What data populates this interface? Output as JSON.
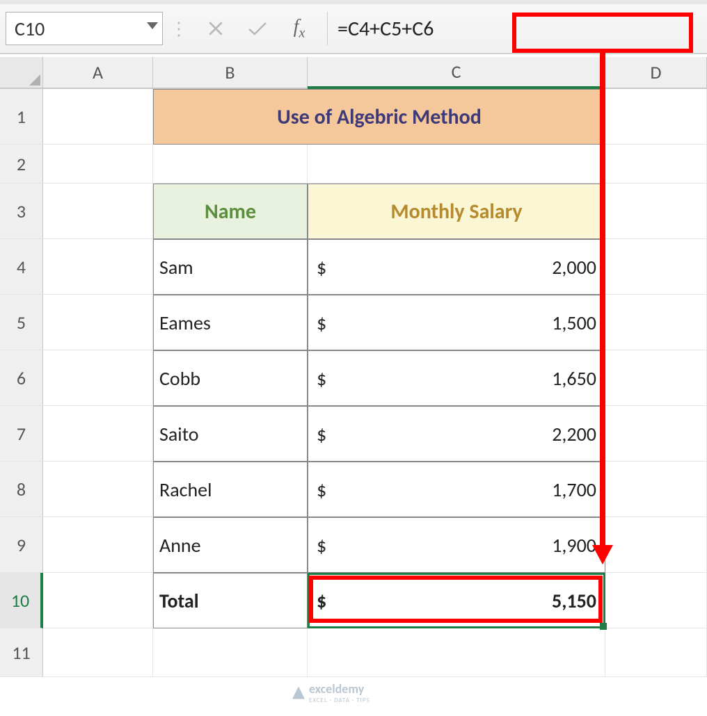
{
  "namebox": {
    "value": "C10"
  },
  "formula_bar": {
    "formula": "=C4+C5+C6"
  },
  "columns": {
    "A": "A",
    "B": "B",
    "C": "C",
    "D": "D"
  },
  "row_labels": [
    "1",
    "2",
    "3",
    "4",
    "5",
    "6",
    "7",
    "8",
    "9",
    "10",
    "11"
  ],
  "title": "Use of Algebric Method",
  "headers": {
    "name": "Name",
    "salary": "Monthly Salary"
  },
  "rows": [
    {
      "name": "Sam",
      "cur": "$",
      "val": "2,000"
    },
    {
      "name": "Eames",
      "cur": "$",
      "val": "1,500"
    },
    {
      "name": "Cobb",
      "cur": "$",
      "val": "1,650"
    },
    {
      "name": "Saito",
      "cur": "$",
      "val": "2,200"
    },
    {
      "name": "Rachel",
      "cur": "$",
      "val": "1,700"
    },
    {
      "name": "Anne",
      "cur": "$",
      "val": "1,900"
    }
  ],
  "total": {
    "label": "Total",
    "cur": "$",
    "val": "5,150"
  },
  "watermark": {
    "main": "exceldemy",
    "sub": "EXCEL · DATA · TIPS"
  }
}
